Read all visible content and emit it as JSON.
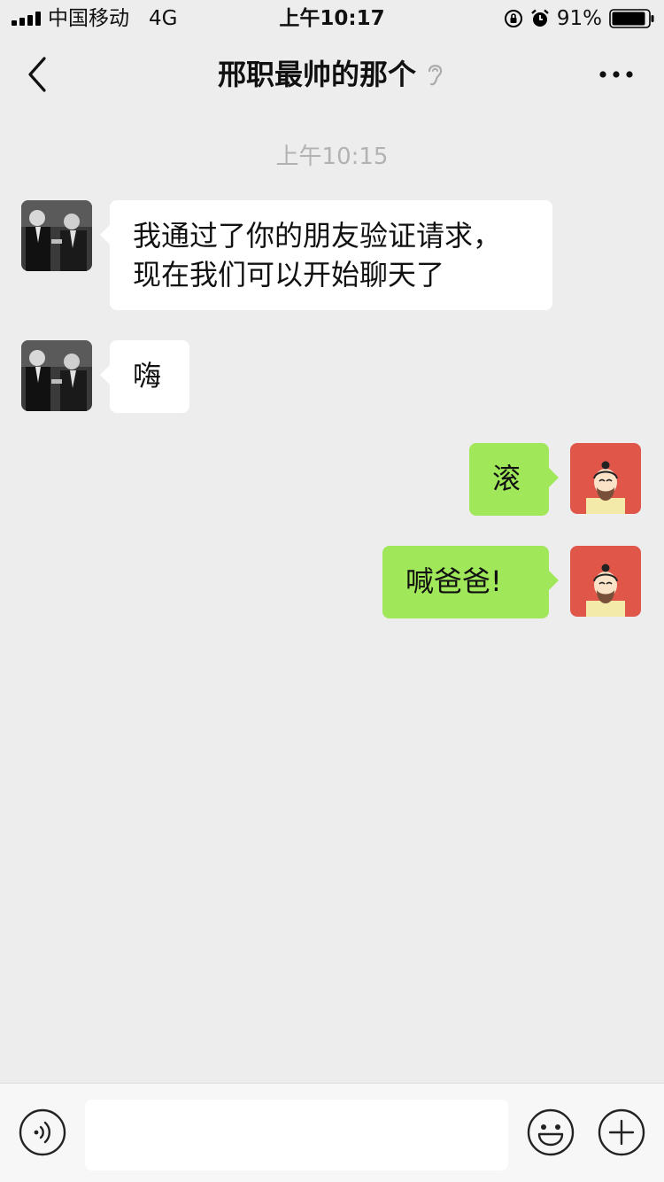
{
  "status_bar": {
    "carrier": "中国移动",
    "network": "4G",
    "time": "上午10:17",
    "battery_percent": "91%",
    "icons": [
      "signal-bars",
      "orientation-lock-icon",
      "alarm-icon",
      "battery-icon"
    ]
  },
  "nav": {
    "title": "邢职最帅的那个",
    "back_icon": "chevron-left-icon",
    "ear_icon": "ear-icon",
    "more_icon": "more-dots-icon"
  },
  "chat": {
    "timestamp": "上午10:15",
    "messages": [
      {
        "side": "left",
        "lines": [
          "我通过了你的朋友验证请求，",
          "现在我们可以开始聊天了"
        ]
      },
      {
        "side": "left",
        "text": "嗨"
      },
      {
        "side": "right",
        "text": "滚"
      },
      {
        "side": "right",
        "text": "喊爸爸!"
      }
    ]
  },
  "input_bar": {
    "placeholder": "",
    "icons": [
      "voice-icon",
      "emoji-icon",
      "plus-icon"
    ]
  },
  "colors": {
    "background": "#ededed",
    "bubble_in": "#ffffff",
    "bubble_out": "#a0e75a",
    "my_avatar_bg": "#e0574a",
    "timestamp": "#b2b2b2"
  }
}
